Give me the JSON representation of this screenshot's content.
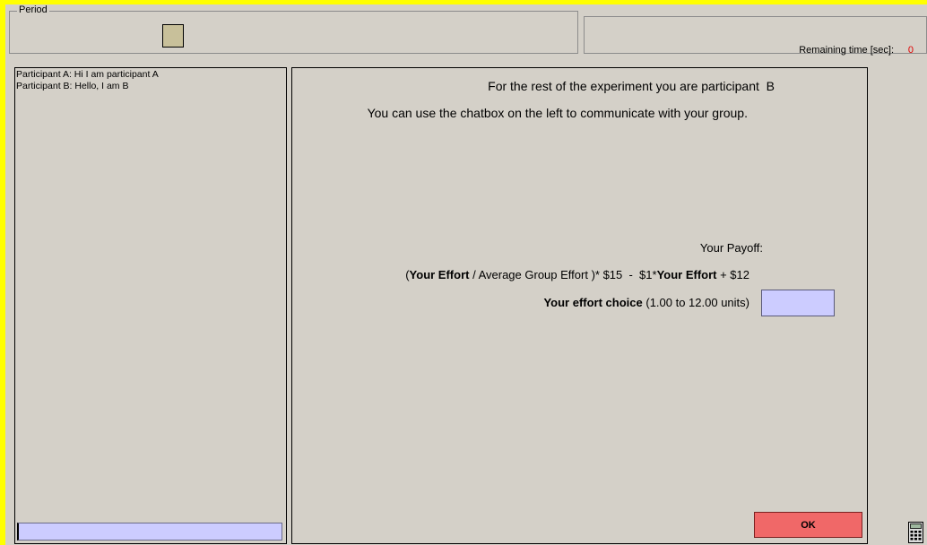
{
  "period_box": {
    "legend": "Period"
  },
  "timer": {
    "label": "Remaining time [sec]:",
    "value": "0"
  },
  "chat": {
    "messages": [
      "Participant A: Hi I am participant A",
      "Participant B: Hello, I am B"
    ],
    "input_value": ""
  },
  "main": {
    "role_prefix": "For the rest of the experiment you are participant",
    "role_value": "B",
    "instructions": "You can use the chatbox on the left to communicate with your group.",
    "payoff_label": "Your Payoff:",
    "formula": {
      "open": "(",
      "your_effort_1": "Your Effort",
      "mid1": " / Average Group Effort )* $15  -  $1*",
      "your_effort_2": "Your Effort",
      "tail": " + $12"
    },
    "effort_choice_bold": "Your effort choice",
    "effort_choice_range": " (1.00 to 12.00 units)",
    "effort_input_value": "",
    "ok_label": "OK"
  },
  "icons": {
    "calculator": "calculator-icon"
  },
  "colors": {
    "outer_border": "#ffff00",
    "background": "#d4d0c8",
    "input_fill": "#ccccff",
    "ok_button": "#f06868",
    "timer_value": "#e00000",
    "period_indicator": "#c8c09a"
  }
}
